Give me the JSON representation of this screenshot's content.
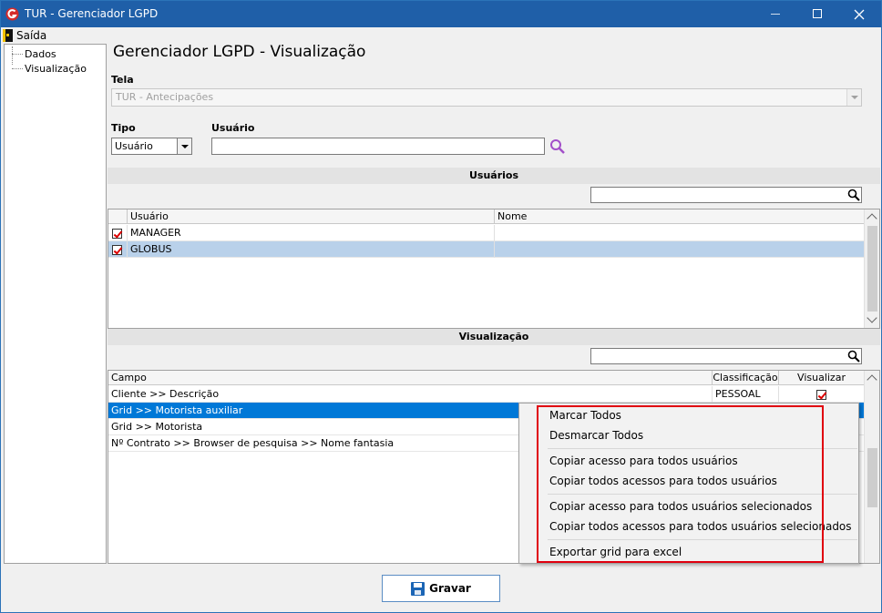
{
  "window": {
    "title": "TUR - Gerenciador LGPD"
  },
  "menu": {
    "exit_label": "Saída"
  },
  "tree": {
    "items": [
      "Dados",
      "Visualização"
    ]
  },
  "page": {
    "title": "Gerenciador LGPD - Visualização"
  },
  "tela": {
    "label": "Tela",
    "value": "TUR - Antecipações"
  },
  "tipo": {
    "label": "Tipo",
    "value": "Usuário"
  },
  "usuario": {
    "label": "Usuário",
    "value": ""
  },
  "usuarios_section": {
    "header": "Usuários",
    "columns": [
      "Usuário",
      "Nome"
    ],
    "rows": [
      {
        "checked": true,
        "usuario": "MANAGER",
        "nome": ""
      },
      {
        "checked": true,
        "usuario": "GLOBUS",
        "nome": ""
      }
    ]
  },
  "visualizacao_section": {
    "header": "Visualização",
    "columns": [
      "Campo",
      "Classificação",
      "Visualizar"
    ],
    "rows": [
      {
        "campo": "Cliente >> Descrição",
        "classificacao": "PESSOAL",
        "visualizar": true
      },
      {
        "campo": "Grid >> Motorista auxiliar",
        "classificacao": "",
        "visualizar": false
      },
      {
        "campo": "Grid >> Motorista",
        "classificacao": "",
        "visualizar": false
      },
      {
        "campo": "Nº Contrato >> Browser de pesquisa >> Nome fantasia",
        "classificacao": "",
        "visualizar": false
      }
    ]
  },
  "context_menu": {
    "items": [
      "Marcar Todos",
      "Desmarcar Todos",
      "Copiar acesso para todos usuários",
      "Copiar todos acessos para todos usuários",
      "Copiar acesso para todos usuários selecionados",
      "Copiar todos acessos para todos usuários selecionados",
      "Exportar grid para excel"
    ]
  },
  "buttons": {
    "save_label": "Gravar"
  },
  "colors": {
    "titlebar": "#1f5fa8",
    "selection": "#0078d7",
    "highlight_border": "#e0000f",
    "checkmark": "#dd0000"
  }
}
